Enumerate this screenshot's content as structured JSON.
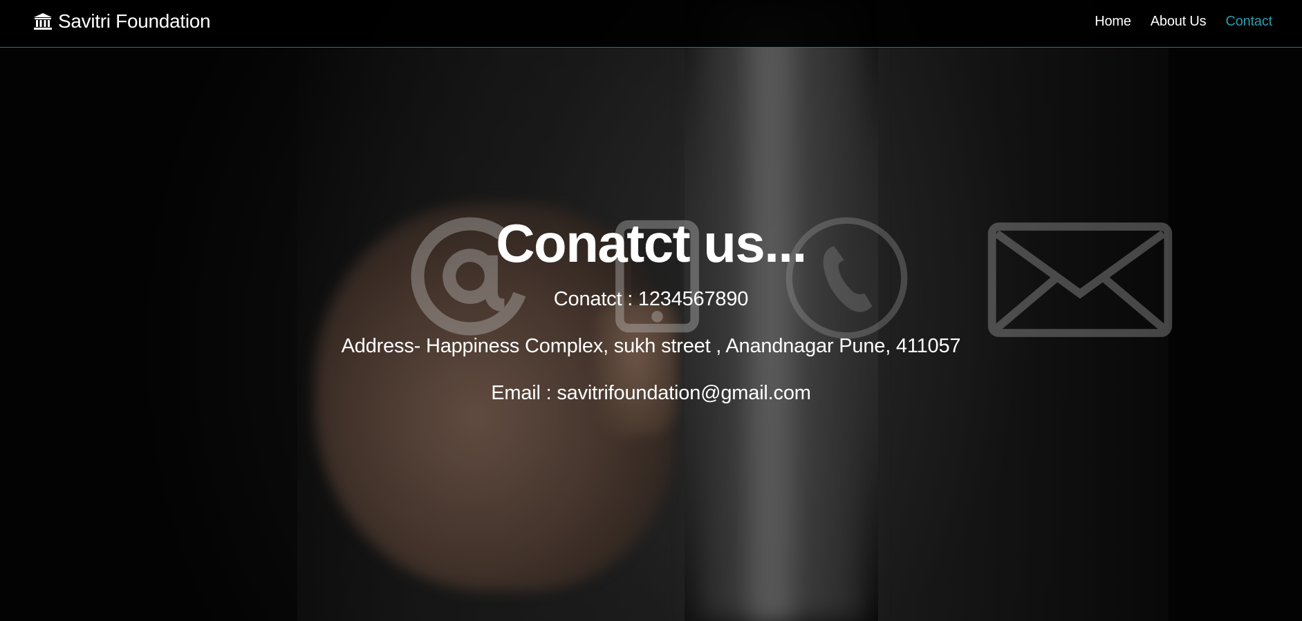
{
  "navbar": {
    "brand_text": "Savitri Foundation",
    "brand_icon": "institution-icon",
    "items": [
      {
        "label": "Home",
        "active": false
      },
      {
        "label": "About Us",
        "active": false
      },
      {
        "label": "Contact",
        "active": true
      }
    ],
    "accent_color": "#2b9cab"
  },
  "hero": {
    "title": "Conatct us...",
    "phone_line": "Conatct : 1234567890",
    "address_line": "Address- Happiness Complex, sukh street , Anandnagar Pune, 411057",
    "email_line": "Email : savitrifoundation@gmail.com"
  },
  "background_icons": [
    "at-sign-icon",
    "smartphone-icon",
    "phone-handset-icon",
    "envelope-icon"
  ]
}
